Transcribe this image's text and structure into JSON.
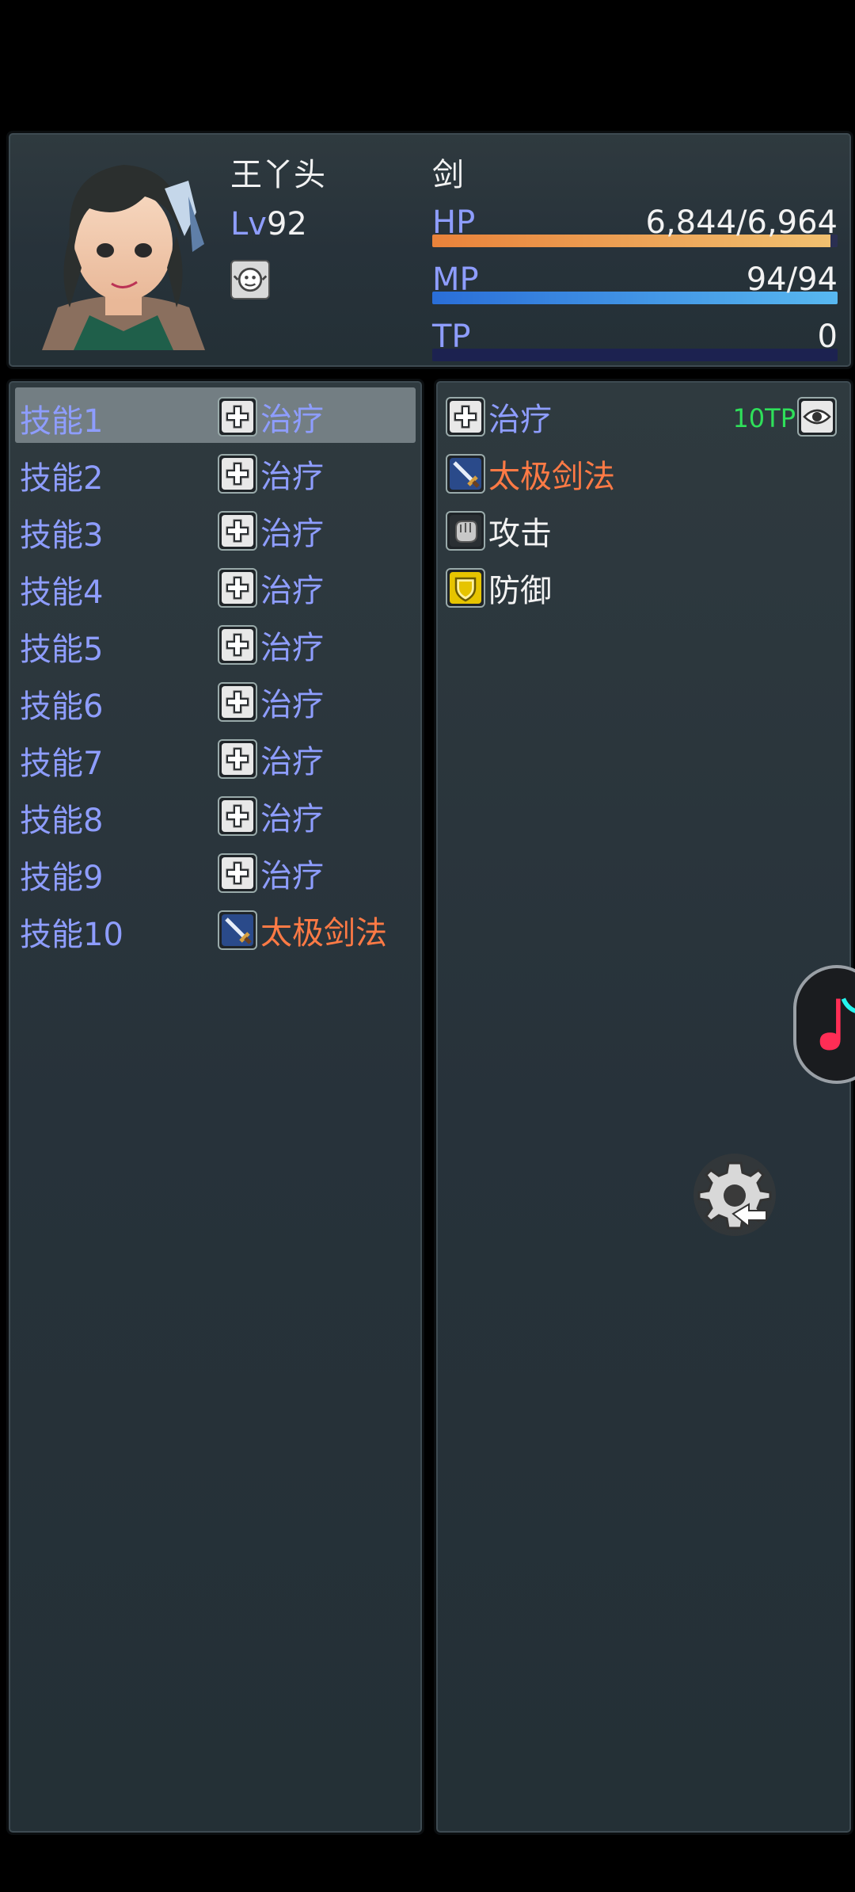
{
  "actor": {
    "name": "王丫头",
    "class": "剑",
    "level_label": "Lv",
    "level": "92",
    "hp_label": "HP",
    "hp_value": "6,844/6,964",
    "hp_fraction": 0.983,
    "mp_label": "MP",
    "mp_value": "94/94",
    "mp_fraction": 1.0,
    "tp_label": "TP",
    "tp_value": "0",
    "tp_fraction": 0.0
  },
  "slots": [
    {
      "label": "技能1",
      "skill": "治疗",
      "icon": "heal-cross-icon",
      "color": "blue"
    },
    {
      "label": "技能2",
      "skill": "治疗",
      "icon": "heal-cross-icon",
      "color": "blue"
    },
    {
      "label": "技能3",
      "skill": "治疗",
      "icon": "heal-cross-icon",
      "color": "blue"
    },
    {
      "label": "技能4",
      "skill": "治疗",
      "icon": "heal-cross-icon",
      "color": "blue"
    },
    {
      "label": "技能5",
      "skill": "治疗",
      "icon": "heal-cross-icon",
      "color": "blue"
    },
    {
      "label": "技能6",
      "skill": "治疗",
      "icon": "heal-cross-icon",
      "color": "blue"
    },
    {
      "label": "技能7",
      "skill": "治疗",
      "icon": "heal-cross-icon",
      "color": "blue"
    },
    {
      "label": "技能8",
      "skill": "治疗",
      "icon": "heal-cross-icon",
      "color": "blue"
    },
    {
      "label": "技能9",
      "skill": "治疗",
      "icon": "heal-cross-icon",
      "color": "blue"
    },
    {
      "label": "技能10",
      "skill": "太极剑法",
      "icon": "sword-icon",
      "color": "orange"
    }
  ],
  "skills": [
    {
      "name": "治疗",
      "icon": "heal-cross-icon",
      "color": "blue",
      "tp_cost": "10TP",
      "cost_icon": "eye-icon"
    },
    {
      "name": "太极剑法",
      "icon": "sword-icon",
      "color": "orange"
    },
    {
      "name": "攻击",
      "icon": "fist-icon",
      "color": "white"
    },
    {
      "name": "防御",
      "icon": "shield-icon",
      "color": "white"
    }
  ],
  "colors": {
    "blue_text": "#8e9dff",
    "orange_text": "#ff7a45",
    "green_text": "#2fe05a"
  }
}
